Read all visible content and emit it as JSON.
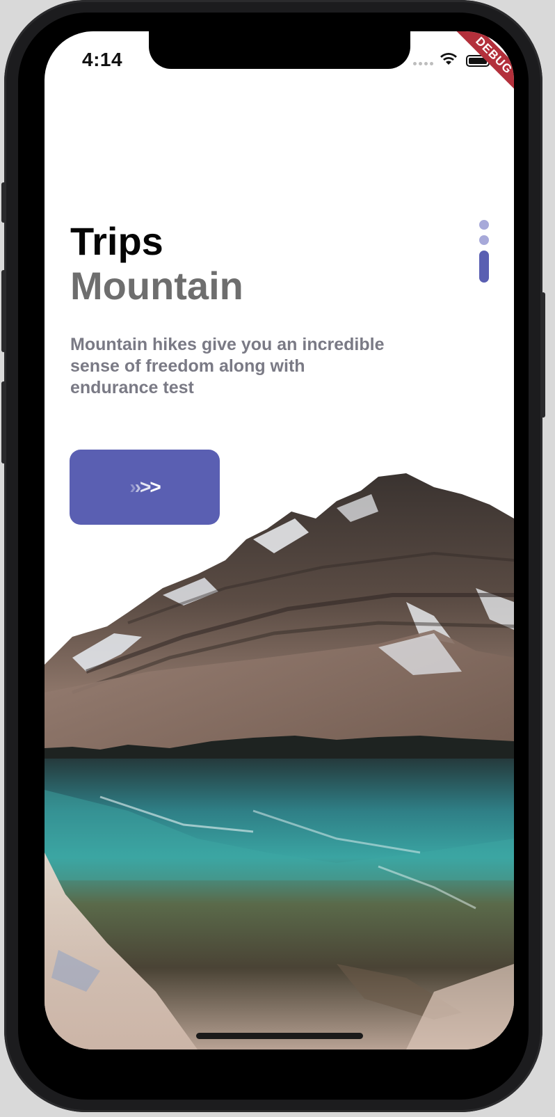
{
  "status_bar": {
    "time": "4:14",
    "debug_label": "DEBUG"
  },
  "content": {
    "title": "Trips",
    "subtitle": "Mountain",
    "description": "Mountain hikes give you an incredible sense of freedom along with endurance test",
    "next_button_label": ">>>>"
  },
  "page_indicator": {
    "total_pages": 3,
    "active_page": 3
  },
  "colors": {
    "accent": "#5a5fb2",
    "indicator_inactive": "#a7a9d9",
    "title": "#050505",
    "subtitle": "#6e6e6e",
    "description": "#7a7a85",
    "debug_ribbon": "#b3303b"
  },
  "icons": {
    "wifi": "wifi-icon",
    "battery": "battery-icon",
    "signal": "cellular-signal-icon"
  }
}
